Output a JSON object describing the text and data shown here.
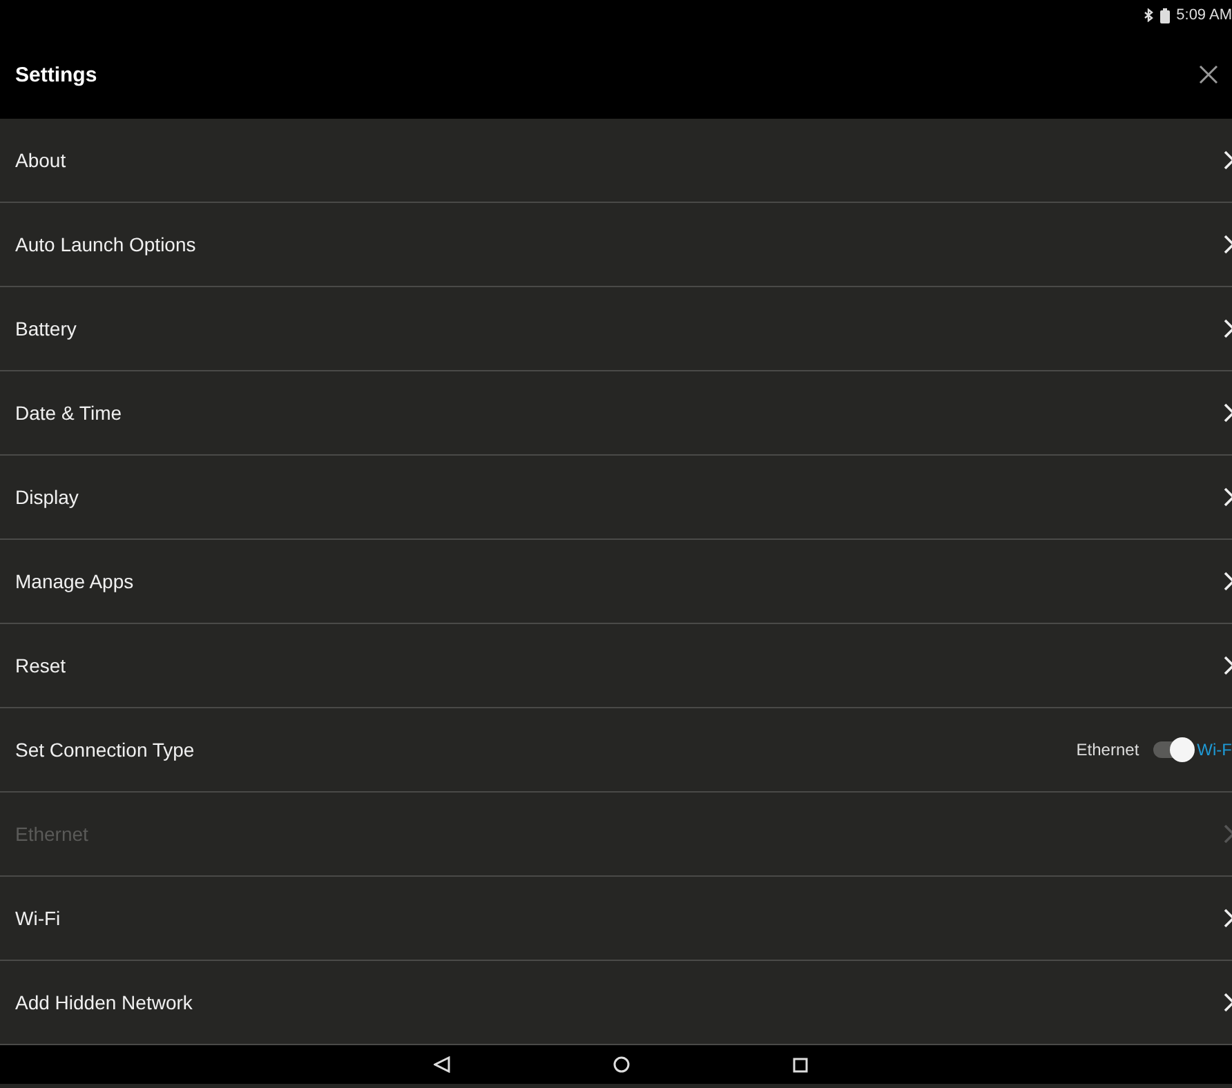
{
  "status_bar": {
    "time": "5:09 AM"
  },
  "header": {
    "title": "Settings"
  },
  "items": [
    {
      "kind": "link",
      "label": "About",
      "disabled": false
    },
    {
      "kind": "link",
      "label": "Auto Launch Options",
      "disabled": false
    },
    {
      "kind": "link",
      "label": "Battery",
      "disabled": false
    },
    {
      "kind": "link",
      "label": "Date & Time",
      "disabled": false
    },
    {
      "kind": "link",
      "label": "Display",
      "disabled": false
    },
    {
      "kind": "link",
      "label": "Manage Apps",
      "disabled": false
    },
    {
      "kind": "link",
      "label": "Reset",
      "disabled": false
    },
    {
      "kind": "toggle",
      "label": "Set Connection Type",
      "off_label": "Ethernet",
      "on_label": "Wi-F",
      "on": true
    },
    {
      "kind": "link",
      "label": "Ethernet",
      "disabled": true
    },
    {
      "kind": "link",
      "label": "Wi-Fi",
      "disabled": false
    },
    {
      "kind": "link",
      "label": "Add Hidden Network",
      "disabled": false
    }
  ]
}
